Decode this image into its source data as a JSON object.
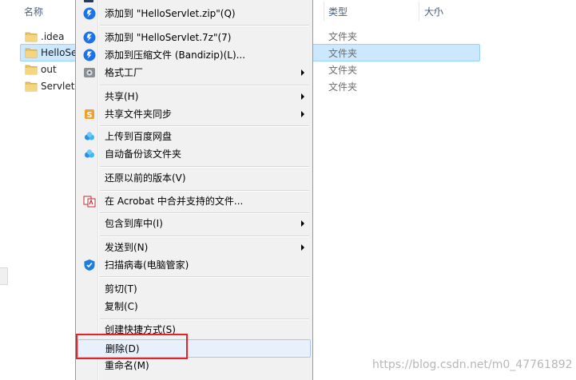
{
  "columns": {
    "name": "名称",
    "type": "类型",
    "size": "大小"
  },
  "files": [
    {
      "name": ".idea",
      "type": "文件夹"
    },
    {
      "name": "HelloSe",
      "type": "文件夹"
    },
    {
      "name": "out",
      "type": "文件夹"
    },
    {
      "name": "ServletD",
      "type": "文件夹"
    }
  ],
  "context_menu": {
    "items": [
      {
        "label": "添加到 \"HelloServlet.zip\"(Q)",
        "icon": "bandizip-icon"
      },
      {
        "label": "添加到 \"HelloServlet.7z\"(7)",
        "icon": "bandizip-icon"
      },
      {
        "label": "添加到压缩文件 (Bandizip)(L)...",
        "icon": "bandizip-icon"
      },
      {
        "label": "格式工厂",
        "icon": "format-factory-icon",
        "submenu": true
      },
      {
        "label": "共享(H)",
        "submenu": true
      },
      {
        "label": "共享文件夹同步",
        "icon": "sync-icon",
        "submenu": true
      },
      {
        "label": "上传到百度网盘",
        "icon": "baidu-cloud-icon"
      },
      {
        "label": "自动备份该文件夹",
        "icon": "baidu-cloud-icon"
      },
      {
        "label": "还原以前的版本(V)"
      },
      {
        "label": "在 Acrobat 中合并支持的文件...",
        "icon": "acrobat-icon"
      },
      {
        "label": "包含到库中(I)",
        "submenu": true
      },
      {
        "label": "发送到(N)",
        "submenu": true
      },
      {
        "label": "扫描病毒(电脑管家)",
        "icon": "shield-icon"
      },
      {
        "label": "剪切(T)"
      },
      {
        "label": "复制(C)"
      },
      {
        "label": "创建快捷方式(S)"
      },
      {
        "label": "删除(D)"
      },
      {
        "label": "重命名(M)"
      }
    ]
  },
  "watermark": "https://blog.csdn.net/m0_47761892",
  "colors": {
    "selection": "#cce8ff",
    "highlight_box": "#e8212a",
    "bandizip": "#1a73e8"
  }
}
